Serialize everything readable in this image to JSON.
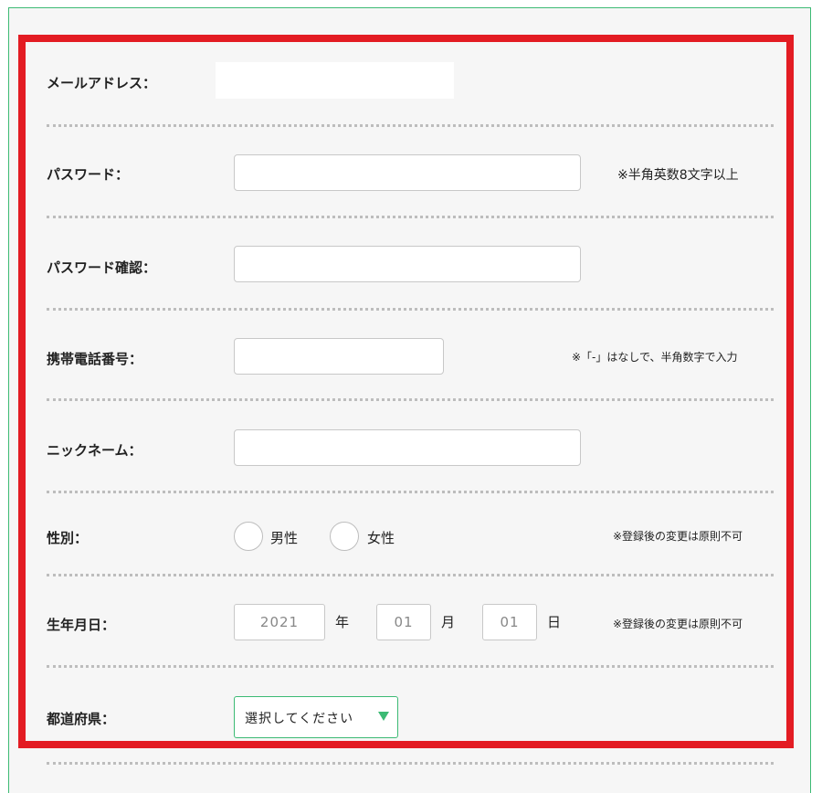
{
  "form": {
    "email": {
      "label": "メールアドレス：",
      "value": ""
    },
    "password": {
      "label": "パスワード：",
      "value": "",
      "note": "※半角英数8文字以上"
    },
    "password_confirm": {
      "label": "パスワード確認：",
      "value": ""
    },
    "phone": {
      "label": "携帯電話番号：",
      "value": "",
      "note": "※「-」はなしで、半角数字で入力"
    },
    "nickname": {
      "label": "ニックネーム：",
      "value": ""
    },
    "gender": {
      "label": "性別：",
      "options": [
        "男性",
        "女性"
      ],
      "note": "※登録後の変更は原則不可"
    },
    "birthday": {
      "label": "生年月日：",
      "year": "2021",
      "year_unit": "年",
      "month": "01",
      "month_unit": "月",
      "day": "01",
      "day_unit": "日",
      "note": "※登録後の変更は原則不可"
    },
    "prefecture": {
      "label": "都道府県：",
      "selected": "選択してください"
    }
  },
  "colors": {
    "accent": "#3cba74",
    "highlight": "#e31c23",
    "background": "#f6f6f6"
  }
}
